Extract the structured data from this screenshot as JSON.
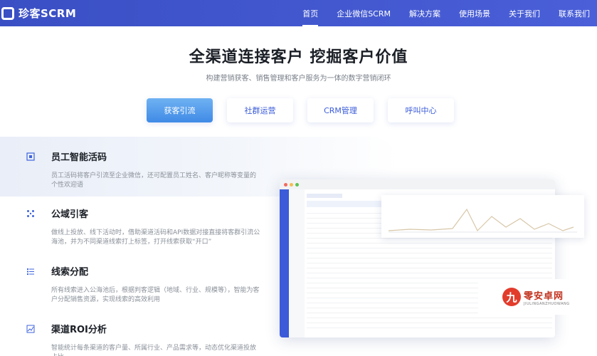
{
  "brand": {
    "name": "珍客SCRM"
  },
  "nav": [
    {
      "label": "首页",
      "active": true
    },
    {
      "label": "企业微信SCRM"
    },
    {
      "label": "解决方案"
    },
    {
      "label": "使用场景"
    },
    {
      "label": "关于我们"
    },
    {
      "label": "联系我们"
    }
  ],
  "hero": {
    "title": "全渠道连接客户 挖掘客户价值",
    "subtitle": "构建营销获客、销售管理和客户服务为一体的数字营销闭环"
  },
  "tabs": [
    {
      "label": "获客引流",
      "active": true
    },
    {
      "label": "社群运营"
    },
    {
      "label": "CRM管理"
    },
    {
      "label": "呼叫中心"
    }
  ],
  "features": [
    {
      "icon": "qr-code-icon",
      "title": "员工智能活码",
      "desc": "员工活码将客户引流至企业微信，还可配置员工姓名、客户昵称等变量的个性欢迎语"
    },
    {
      "icon": "channel-icon",
      "title": "公域引客",
      "desc": "做线上投放、线下活动时，借助渠道活码和API数据对接直接将客群引流公海池，并为不同渠道线索打上标签，打开线索获取“开口”"
    },
    {
      "icon": "list-icon",
      "title": "线索分配",
      "desc": "所有线索进入公海池后，根据判客逻辑（地域、行业、规模等），智能为客户分配销售资源，实现线索的高效利用"
    },
    {
      "icon": "chart-icon",
      "title": "渠道ROI分析",
      "desc": "智能统计每条渠道的客户量、所属行业、产品需求等，动态优化渠道投放占比"
    }
  ],
  "watermark": {
    "badge": "九",
    "cn": "零安卓网",
    "en": "JIULINGANZHUOWANG"
  },
  "colors": {
    "header": "#3a4fc4",
    "accent": "#3e63dd",
    "tab_active": "#3f8ae6"
  }
}
